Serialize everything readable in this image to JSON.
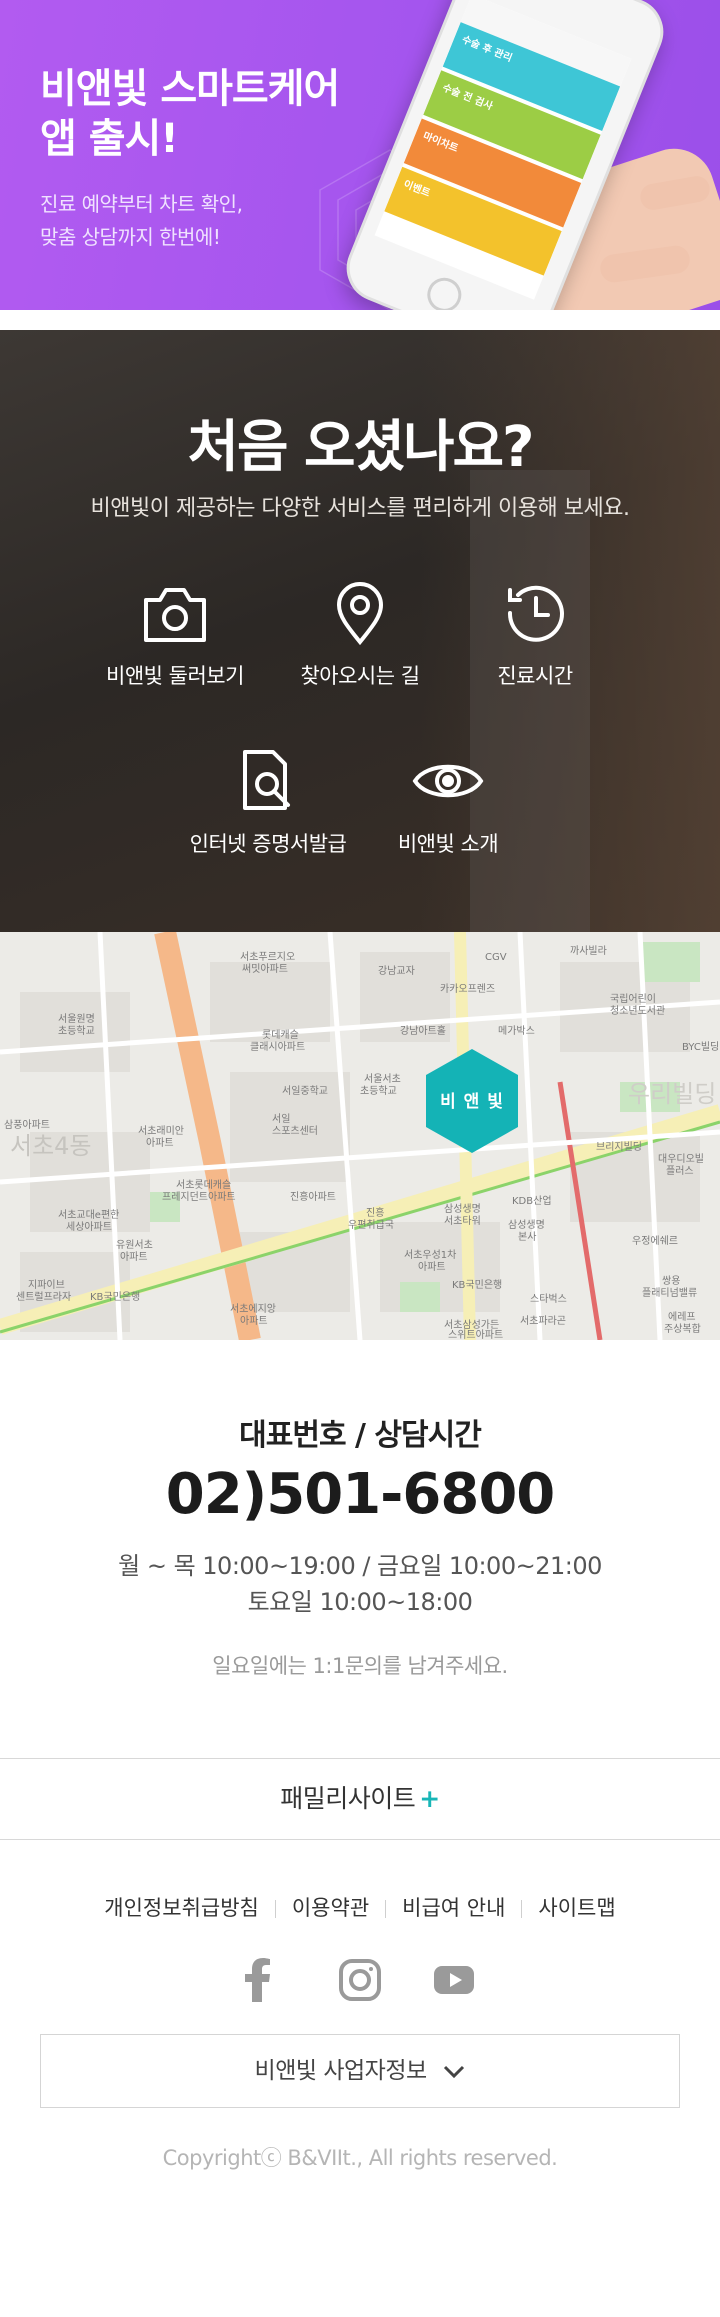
{
  "banner": {
    "title": "비앤빛 스마트케어\n앱 출시!",
    "subtitle": "진료 예약부터 차트 확인,\n맞춤 상담까지 한번에!",
    "brand_color": "#a455ee",
    "phone_rows": [
      "수술 후 관리",
      "수술 전 검사",
      "마이차트",
      "이벤트"
    ]
  },
  "visit": {
    "title": "처음 오셨나요?",
    "subtitle": "비앤빛이 제공하는 다양한 서비스를 편리하게 이용해 보세요.",
    "services": [
      {
        "label": "비앤빛 둘러보기",
        "icon": "camera-icon"
      },
      {
        "label": "찾아오시는 길",
        "icon": "location-pin-icon"
      },
      {
        "label": "진료시간",
        "icon": "clock-icon"
      },
      {
        "label": "인터넷 증명서발급",
        "icon": "document-search-icon"
      },
      {
        "label": "비앤빛 소개",
        "icon": "eye-icon"
      }
    ]
  },
  "map": {
    "badge": "비 앤 빛",
    "badge_color": "#14b3b6",
    "labels": [
      "서초푸르지오 써밋아파트",
      "강남교자",
      "CGV",
      "까사빌라",
      "카카오프렌즈",
      "국립어린이 청소년도서관",
      "롯데캐슬 클래시아파트",
      "강남아트홀",
      "메가박스",
      "BYC빌딩",
      "서일중학교",
      "서울서초 초등학교",
      "서울원명 초등학교",
      "서일 스포츠센터",
      "서초래미안 아파트",
      "삼풍아파트",
      "서초4동",
      "우리빌딩",
      "대우디오빌 플러스",
      "서초교대e편한 세상아파트",
      "서초롯데캐슬 프레지던트아파트",
      "진흥아파트",
      "진흥 우편취급국",
      "삼성생명 서초타워",
      "삼성생명 본사",
      "KDB산업",
      "우정에쉐르",
      "유원서초 아파트",
      "서초우성1차 아파트",
      "KB국민은행",
      "쌍용 플래티넘밸류",
      "지파이브 센트럴프라자",
      "서초에지앙 아파트",
      "스타벅스",
      "에레프 주상복합",
      "서초파라곤",
      "서초삼성가든 스위트아파트"
    ]
  },
  "contact": {
    "title": "대표번호 / 상담시간",
    "phone": "02)501-6800",
    "hours_weekday": "월 ~ 목 10:00~19:00 / 금요일 10:00~21:00",
    "hours_saturday": "토요일 10:00~18:00",
    "sunday_note": "일요일에는 1:1문의를 남겨주세요."
  },
  "footer": {
    "family_label": "패밀리사이트",
    "family_plus": "+",
    "links": [
      "개인정보취급방침",
      "이용약관",
      "비급여 안내",
      "사이트맵"
    ],
    "social": [
      "facebook-icon",
      "instagram-icon",
      "youtube-icon"
    ],
    "biz_info_label": "비앤빛 사업자정보",
    "copyright": "Copyrightⓒ B&VIIt., All rights reserved."
  }
}
